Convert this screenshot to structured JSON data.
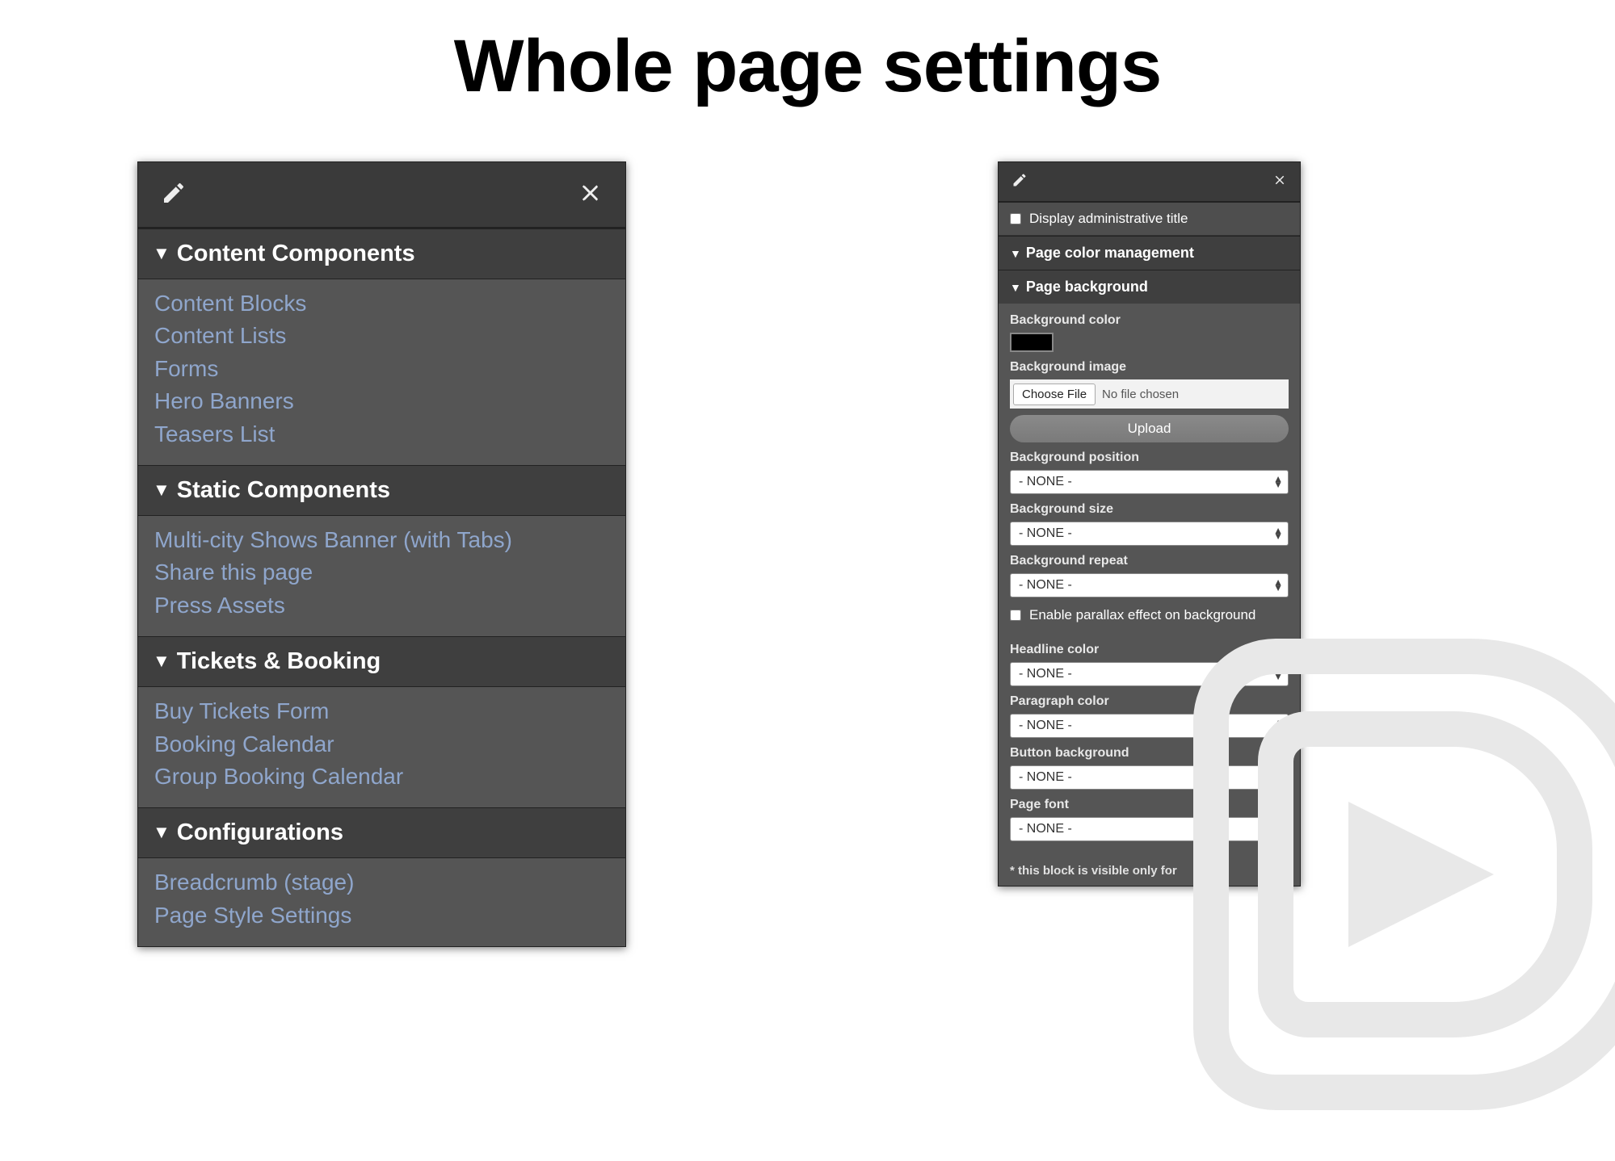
{
  "title": "Whole page settings",
  "leftPanel": {
    "sections": [
      {
        "title": "Content Components",
        "items": [
          "Content Blocks",
          "Content Lists",
          "Forms",
          "Hero Banners",
          "Teasers List"
        ]
      },
      {
        "title": "Static Components",
        "items": [
          "Multi-city Shows Banner (with Tabs)",
          "Share this page",
          "Press Assets"
        ]
      },
      {
        "title": "Tickets & Booking",
        "items": [
          "Buy Tickets Form",
          "Booking Calendar",
          "Group Booking Calendar"
        ]
      },
      {
        "title": "Configurations",
        "items": [
          "Breadcrumb (stage)",
          "Page Style Settings"
        ]
      }
    ]
  },
  "rightPanel": {
    "adminTitleLabel": "Display administrative title",
    "pageColorMgmt": "Page color management",
    "pageBackground": "Page background",
    "bgColorLabel": "Background color",
    "bgColorValue": "#000000",
    "bgImageLabel": "Background image",
    "chooseFile": "Choose File",
    "noFile": "No file chosen",
    "uploadLabel": "Upload",
    "bgPositionLabel": "Background position",
    "bgSizeLabel": "Background size",
    "bgRepeatLabel": "Background repeat",
    "parallaxLabel": "Enable parallax effect on background",
    "headlineColorLabel": "Headline color",
    "paragraphColorLabel": "Paragraph color",
    "buttonBgLabel": "Button background",
    "pageFontLabel": "Page font",
    "noneOption": "- NONE -",
    "footnote": "* this block is visible only for"
  }
}
